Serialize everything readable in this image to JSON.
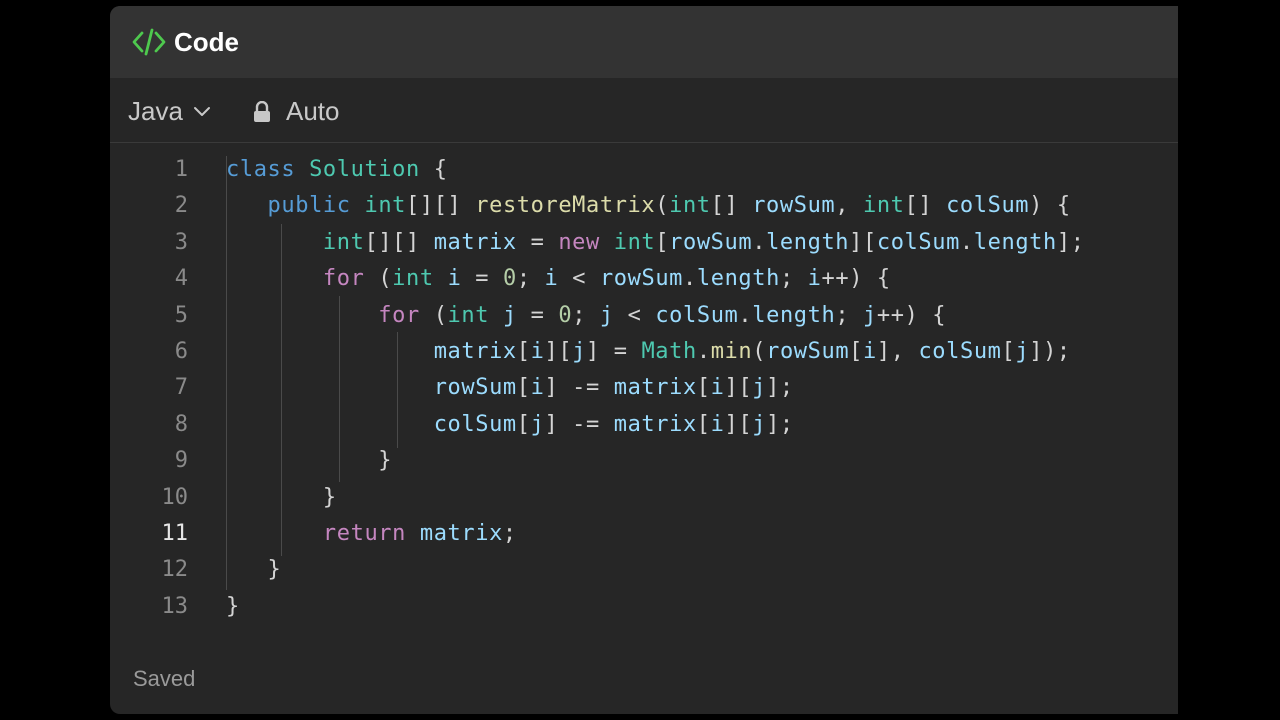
{
  "header": {
    "title": "Code",
    "icon": "code-icon",
    "icon_color": "#4ec94e"
  },
  "toolbar": {
    "language": "Java",
    "mode": "Auto"
  },
  "editor": {
    "active_line": "11",
    "lines": [
      {
        "n": "1",
        "tokens": [
          [
            "kw-blue",
            "class "
          ],
          [
            "cls",
            "Solution"
          ],
          [
            "txt",
            " {"
          ]
        ]
      },
      {
        "n": "2",
        "tokens": [
          [
            "txt",
            "   "
          ],
          [
            "kw-blue",
            "public "
          ],
          [
            "cls",
            "int"
          ],
          [
            "txt",
            "[][] "
          ],
          [
            "fn",
            "restoreMatrix"
          ],
          [
            "txt",
            "("
          ],
          [
            "cls",
            "int"
          ],
          [
            "txt",
            "[] "
          ],
          [
            "var",
            "rowSum"
          ],
          [
            "txt",
            ", "
          ],
          [
            "cls",
            "int"
          ],
          [
            "txt",
            "[] "
          ],
          [
            "var",
            "colSum"
          ],
          [
            "txt",
            ") {"
          ]
        ]
      },
      {
        "n": "3",
        "tokens": [
          [
            "txt",
            "       "
          ],
          [
            "cls",
            "int"
          ],
          [
            "txt",
            "[][] "
          ],
          [
            "var",
            "matrix"
          ],
          [
            "txt",
            " = "
          ],
          [
            "kw-purple",
            "new "
          ],
          [
            "cls",
            "int"
          ],
          [
            "txt",
            "["
          ],
          [
            "var",
            "rowSum"
          ],
          [
            "txt",
            "."
          ],
          [
            "var",
            "length"
          ],
          [
            "txt",
            "]["
          ],
          [
            "var",
            "colSum"
          ],
          [
            "txt",
            "."
          ],
          [
            "var",
            "length"
          ],
          [
            "txt",
            "];"
          ]
        ]
      },
      {
        "n": "4",
        "tokens": [
          [
            "txt",
            "       "
          ],
          [
            "kw-purple",
            "for "
          ],
          [
            "txt",
            "("
          ],
          [
            "cls",
            "int "
          ],
          [
            "var",
            "i"
          ],
          [
            "txt",
            " = "
          ],
          [
            "num",
            "0"
          ],
          [
            "txt",
            "; "
          ],
          [
            "var",
            "i"
          ],
          [
            "txt",
            " < "
          ],
          [
            "var",
            "rowSum"
          ],
          [
            "txt",
            "."
          ],
          [
            "var",
            "length"
          ],
          [
            "txt",
            "; "
          ],
          [
            "var",
            "i"
          ],
          [
            "txt",
            "++) {"
          ]
        ]
      },
      {
        "n": "5",
        "tokens": [
          [
            "txt",
            "           "
          ],
          [
            "kw-purple",
            "for "
          ],
          [
            "txt",
            "("
          ],
          [
            "cls",
            "int "
          ],
          [
            "var",
            "j"
          ],
          [
            "txt",
            " = "
          ],
          [
            "num",
            "0"
          ],
          [
            "txt",
            "; "
          ],
          [
            "var",
            "j"
          ],
          [
            "txt",
            " < "
          ],
          [
            "var",
            "colSum"
          ],
          [
            "txt",
            "."
          ],
          [
            "var",
            "length"
          ],
          [
            "txt",
            "; "
          ],
          [
            "var",
            "j"
          ],
          [
            "txt",
            "++) {"
          ]
        ]
      },
      {
        "n": "6",
        "tokens": [
          [
            "txt",
            "               "
          ],
          [
            "var",
            "matrix"
          ],
          [
            "txt",
            "["
          ],
          [
            "var",
            "i"
          ],
          [
            "txt",
            "]["
          ],
          [
            "var",
            "j"
          ],
          [
            "txt",
            "] = "
          ],
          [
            "cls",
            "Math"
          ],
          [
            "txt",
            "."
          ],
          [
            "fn",
            "min"
          ],
          [
            "txt",
            "("
          ],
          [
            "var",
            "rowSum"
          ],
          [
            "txt",
            "["
          ],
          [
            "var",
            "i"
          ],
          [
            "txt",
            "], "
          ],
          [
            "var",
            "colSum"
          ],
          [
            "txt",
            "["
          ],
          [
            "var",
            "j"
          ],
          [
            "txt",
            "]);"
          ]
        ]
      },
      {
        "n": "7",
        "tokens": [
          [
            "txt",
            "               "
          ],
          [
            "var",
            "rowSum"
          ],
          [
            "txt",
            "["
          ],
          [
            "var",
            "i"
          ],
          [
            "txt",
            "] -= "
          ],
          [
            "var",
            "matrix"
          ],
          [
            "txt",
            "["
          ],
          [
            "var",
            "i"
          ],
          [
            "txt",
            "]["
          ],
          [
            "var",
            "j"
          ],
          [
            "txt",
            "];"
          ]
        ]
      },
      {
        "n": "8",
        "tokens": [
          [
            "txt",
            "               "
          ],
          [
            "var",
            "colSum"
          ],
          [
            "txt",
            "["
          ],
          [
            "var",
            "j"
          ],
          [
            "txt",
            "] -= "
          ],
          [
            "var",
            "matrix"
          ],
          [
            "txt",
            "["
          ],
          [
            "var",
            "i"
          ],
          [
            "txt",
            "]["
          ],
          [
            "var",
            "j"
          ],
          [
            "txt",
            "];"
          ]
        ]
      },
      {
        "n": "9",
        "tokens": [
          [
            "txt",
            "           }"
          ]
        ]
      },
      {
        "n": "10",
        "tokens": [
          [
            "txt",
            "       }"
          ]
        ]
      },
      {
        "n": "11",
        "tokens": [
          [
            "txt",
            "       "
          ],
          [
            "kw-purple",
            "return "
          ],
          [
            "var",
            "matrix"
          ],
          [
            "txt",
            ";"
          ]
        ]
      },
      {
        "n": "12",
        "tokens": [
          [
            "txt",
            "   }"
          ]
        ]
      },
      {
        "n": "13",
        "tokens": [
          [
            "txt",
            "}"
          ]
        ]
      }
    ]
  },
  "footer": {
    "status": "Saved"
  }
}
